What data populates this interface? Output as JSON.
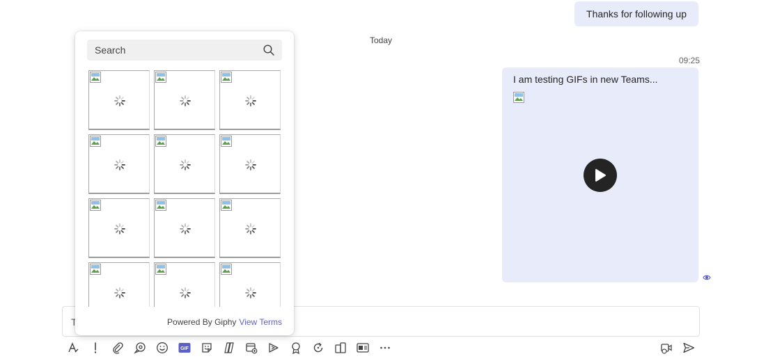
{
  "chat": {
    "previous_message": "Thanks for following up",
    "day_divider": "Today",
    "message": {
      "time": "09:25",
      "text": "I am testing GIFs in new Teams..."
    }
  },
  "compose": {
    "visible_text": "T"
  },
  "giphy": {
    "search_placeholder": "Search",
    "tile_count": 12,
    "powered_by": "Powered By Giphy",
    "view_terms": "View Terms"
  },
  "toolbar": {
    "left": [
      "format-icon",
      "priority-icon",
      "attach-icon",
      "loop-icon",
      "emoji-icon",
      "gif-icon",
      "sticker-icon",
      "copilot-icon",
      "schedule-meeting-icon",
      "stream-icon",
      "praise-icon",
      "updates-icon",
      "apps-icon",
      "forms-icon",
      "more-options-icon"
    ],
    "right": [
      "video-clip-icon",
      "send-icon"
    ],
    "gif_label": "GIF"
  },
  "colors": {
    "bubble": "#e8ebfa",
    "accent": "#5b5fc7"
  }
}
